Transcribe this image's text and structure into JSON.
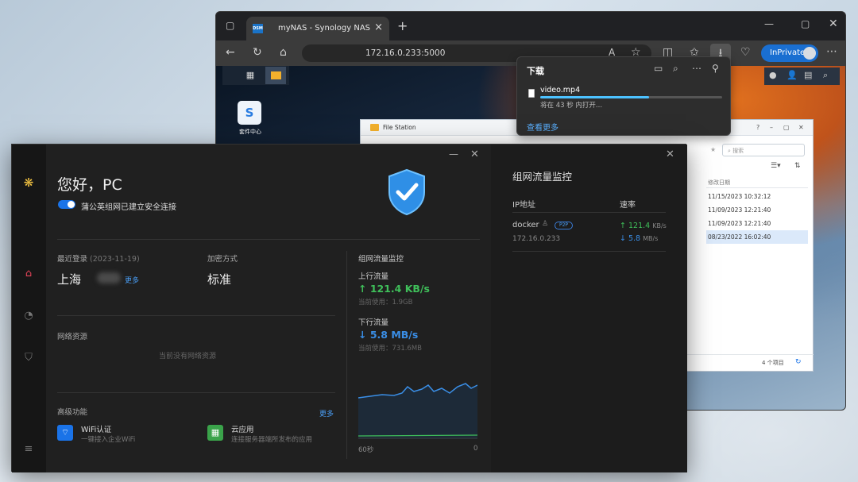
{
  "browser": {
    "tab_title": "myNAS - Synology NAS",
    "tab_favicon": "DSM",
    "address": "172.16.0.233:5000",
    "inprivate_label": "InPrivate"
  },
  "dsm": {
    "package_center_label": "套件中心"
  },
  "file_station": {
    "title": "File Station",
    "search_placeholder": "搜索",
    "col_modified": "修改日期",
    "rows": [
      "11/15/2023 10:32:12",
      "11/09/2023 12:21:40",
      "11/09/2023 12:21:40",
      "08/23/2022 16:02:40"
    ],
    "item_count": "4 个项目"
  },
  "downloads": {
    "title": "下载",
    "file_name": "video.mp4",
    "progress": 0.6,
    "status": "将在 43 秒 内打开...",
    "see_more": "查看更多"
  },
  "vpn": {
    "greeting": "您好，PC",
    "connection_status": "蒲公英组网已建立安全连接",
    "last_login_label": "最近登录",
    "last_login_date": "(2023-11-19)",
    "location": "上海",
    "more": "更多",
    "encryption_label": "加密方式",
    "encryption_value": "标准",
    "network_resources_label": "网络资源",
    "no_resources": "当前没有网络资源",
    "advanced_label": "高级功能",
    "advanced_more": "更多",
    "wifi_title": "WiFi认证",
    "wifi_desc": "一键接入企业WiFi",
    "cloud_title": "云应用",
    "cloud_desc": "连接服务器端所发布的应用",
    "traffic": {
      "title": "组网流量监控",
      "up_label": "上行流量",
      "up_speed": "↑ 121.4 KB/s",
      "up_used": "当前使用：1.9GB",
      "down_label": "下行流量",
      "down_speed": "↓ 5.8 MB/s",
      "down_used": "当前使用：731.6MB",
      "axis_left": "60秒",
      "axis_right": "0"
    },
    "right": {
      "title": "组网流量监控",
      "col_ip": "IP地址",
      "col_rate": "速率",
      "peer_name": "docker",
      "peer_badge": "P2P",
      "peer_ip": "172.16.0.233",
      "peer_up": "121.4",
      "peer_up_unit": "KB/s",
      "peer_down": "5.8",
      "peer_down_unit": "MB/s"
    }
  },
  "colors": {
    "accent_blue": "#1a73e8",
    "upload_green": "#3fbf5a",
    "download_blue": "#3a8ee6"
  }
}
